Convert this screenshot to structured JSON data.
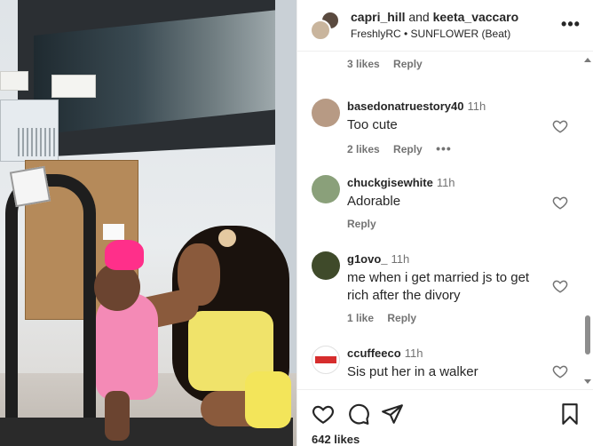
{
  "post": {
    "author1": "capri_hill",
    "joiner": "and",
    "author2": "keeta_vaccaro",
    "audio": "FreshlyRC • SUNFLOWER (Beat)",
    "more_label": "•••"
  },
  "comments": [
    {
      "user": "",
      "time": "",
      "text": "",
      "likes": "3 likes",
      "reply": "Reply",
      "partial": true
    },
    {
      "user": "basedonatruestory40",
      "time": "11h",
      "text": "Too cute",
      "likes": "2 likes",
      "reply": "Reply",
      "dots": "•••"
    },
    {
      "user": "chuckgisewhite",
      "time": "11h",
      "text": "Adorable",
      "likes": "",
      "reply": "Reply"
    },
    {
      "user": "g1ovo_",
      "time": "11h",
      "text": "me when i get married js to get rich after the divory",
      "likes": "1 like",
      "reply": "Reply"
    },
    {
      "user": "ccuffeeco",
      "time": "11h",
      "text": "Sis put her in a walker",
      "likes": "",
      "reply": ""
    }
  ],
  "likes_count": "642 likes",
  "icons": {
    "like": "heart-icon",
    "comment": "comment-icon",
    "share": "share-icon",
    "save": "bookmark-icon"
  },
  "colors": {
    "text": "#262626",
    "secondary": "#737373",
    "divider": "#efefef"
  }
}
